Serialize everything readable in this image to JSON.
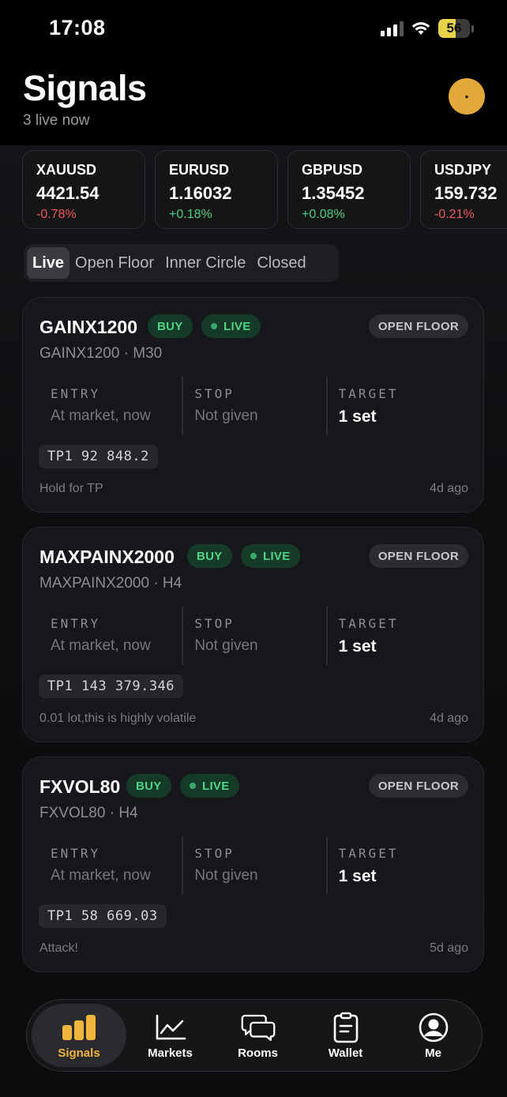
{
  "status_bar": {
    "time": "17:08",
    "battery_level": "56",
    "icons": [
      "cellular-signal-icon",
      "wifi-icon",
      "battery-icon"
    ]
  },
  "header": {
    "title": "Signals",
    "subtitle": "3 live now",
    "avatar_icon": "profile-avatar-icon",
    "avatar_color": "#e3a83a"
  },
  "tickers": [
    {
      "symbol": "XAUUSD",
      "price": "4421.54",
      "change": "-0.78%",
      "direction": "down"
    },
    {
      "symbol": "EURUSD",
      "price": "1.16032",
      "change": "+0.18%",
      "direction": "up"
    },
    {
      "symbol": "GBPUSD",
      "price": "1.35452",
      "change": "+0.08%",
      "direction": "up"
    },
    {
      "symbol": "USDJPY",
      "price": "159.732",
      "change": "-0.21%",
      "direction": "down"
    }
  ],
  "tabs": [
    {
      "label": "Live",
      "active": true
    },
    {
      "label": "Open Floor",
      "active": false
    },
    {
      "label": "Inner Circle",
      "active": false
    },
    {
      "label": "Closed",
      "active": false
    }
  ],
  "stat_labels": {
    "entry": "ENTRY",
    "stop": "STOP",
    "target": "TARGET"
  },
  "signals": [
    {
      "name": "GAINX1200",
      "side": "BUY",
      "status": "LIVE",
      "room": "OPEN FLOOR",
      "subtitle": "GAINX1200 · M30",
      "entry": "At market, now",
      "stop": "Not given",
      "target": "1 set",
      "tp": "TP1  92 848.2",
      "note": "Hold for TP",
      "age": "4d ago"
    },
    {
      "name": "MAXPAINX2000",
      "side": "BUY",
      "status": "LIVE",
      "room": "OPEN FLOOR",
      "subtitle": "MAXPAINX2000 · H4",
      "entry": "At market, now",
      "stop": "Not given",
      "target": "1 set",
      "tp": "TP1  143 379.346",
      "note": "0.01 lot,this is highly volatile",
      "age": "4d ago"
    },
    {
      "name": "FXVOL80",
      "side": "BUY",
      "status": "LIVE",
      "room": "OPEN FLOOR",
      "subtitle": "FXVOL80 · H4",
      "entry": "At market, now",
      "stop": "Not given",
      "target": "1 set",
      "tp": "TP1  58 669.03",
      "note": "Attack!",
      "age": "5d ago"
    }
  ],
  "bottom_nav": [
    {
      "label": "Signals",
      "icon": "bar-chart-icon",
      "active": true
    },
    {
      "label": "Markets",
      "icon": "line-chart-icon",
      "active": false
    },
    {
      "label": "Rooms",
      "icon": "chat-bubbles-icon",
      "active": false
    },
    {
      "label": "Wallet",
      "icon": "wallet-receipt-icon",
      "active": false
    },
    {
      "label": "Me",
      "icon": "user-circle-icon",
      "active": false
    }
  ],
  "colors": {
    "accent": "#f0b53d",
    "positive": "#4cd07d",
    "negative": "#ef5a5a",
    "background": "#000000",
    "card": "#16171a"
  }
}
